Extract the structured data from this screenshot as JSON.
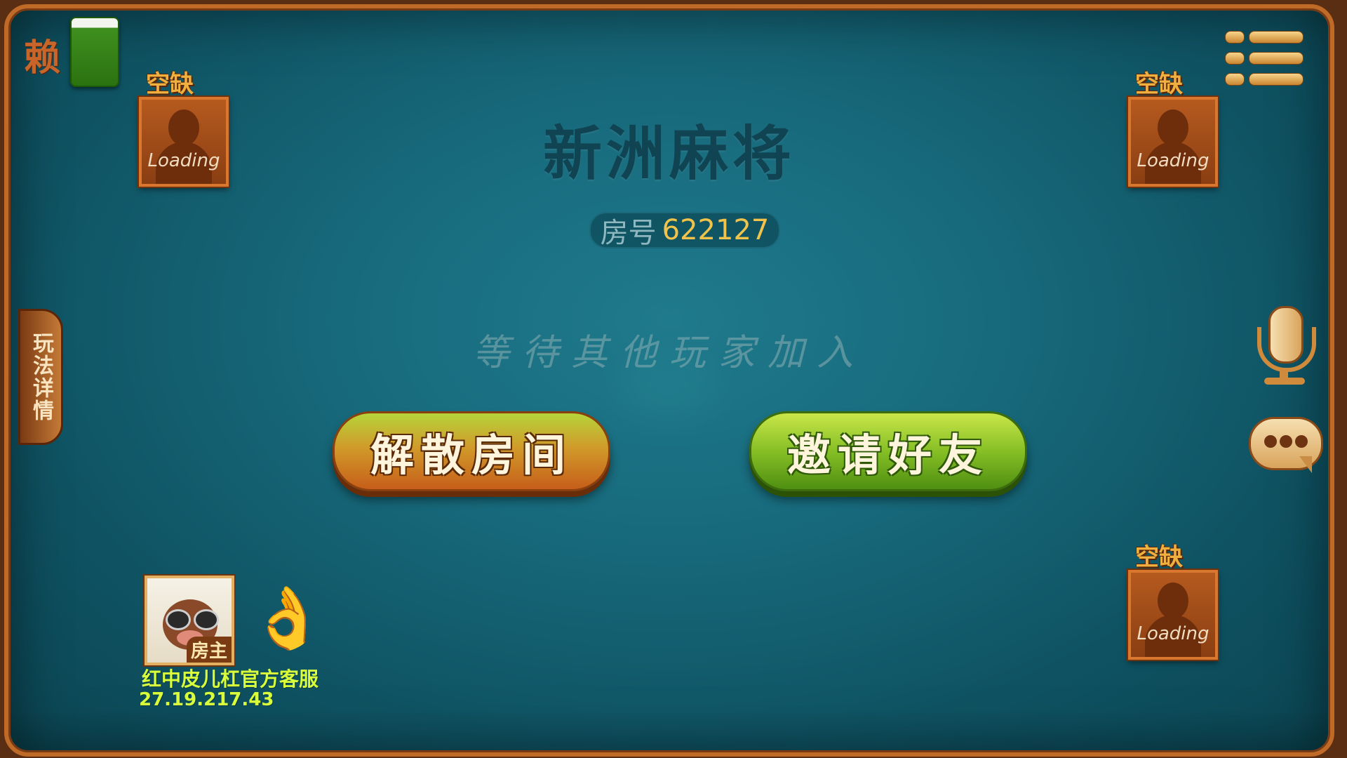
{
  "header": {
    "laizi_label": "赖",
    "laizi_tile_color": "#2b7210"
  },
  "icons": {
    "menu": "menu-icon",
    "microphone": "microphone-icon",
    "chat": "chat-bubble-icon",
    "ready": "ok-hand-icon"
  },
  "room": {
    "game_title": "新洲麻将",
    "room_label": "房号",
    "room_number": "622127",
    "waiting_text": "等待其他玩家加入"
  },
  "seats": [
    {
      "position": "top-left",
      "status": "空缺",
      "avatar_text": "Loading"
    },
    {
      "position": "top-right",
      "status": "空缺",
      "avatar_text": "Loading"
    },
    {
      "position": "bottom-right",
      "status": "空缺",
      "avatar_text": "Loading"
    }
  ],
  "self_player": {
    "name": "红中皮儿杠官方客服",
    "ip": "27.19.217.43",
    "badge": "房主"
  },
  "buttons": {
    "dissolve": "解散房间",
    "invite": "邀请好友"
  },
  "side_tab": {
    "rules_label": "玩法详情"
  },
  "colors": {
    "table_felt": "#176a7c",
    "frame_wood": "#c06a28",
    "room_number": "#f2c34a",
    "player_text": "#d8ff3a",
    "invite_button": "#86bf25",
    "dissolve_button": "#c65e1a"
  }
}
